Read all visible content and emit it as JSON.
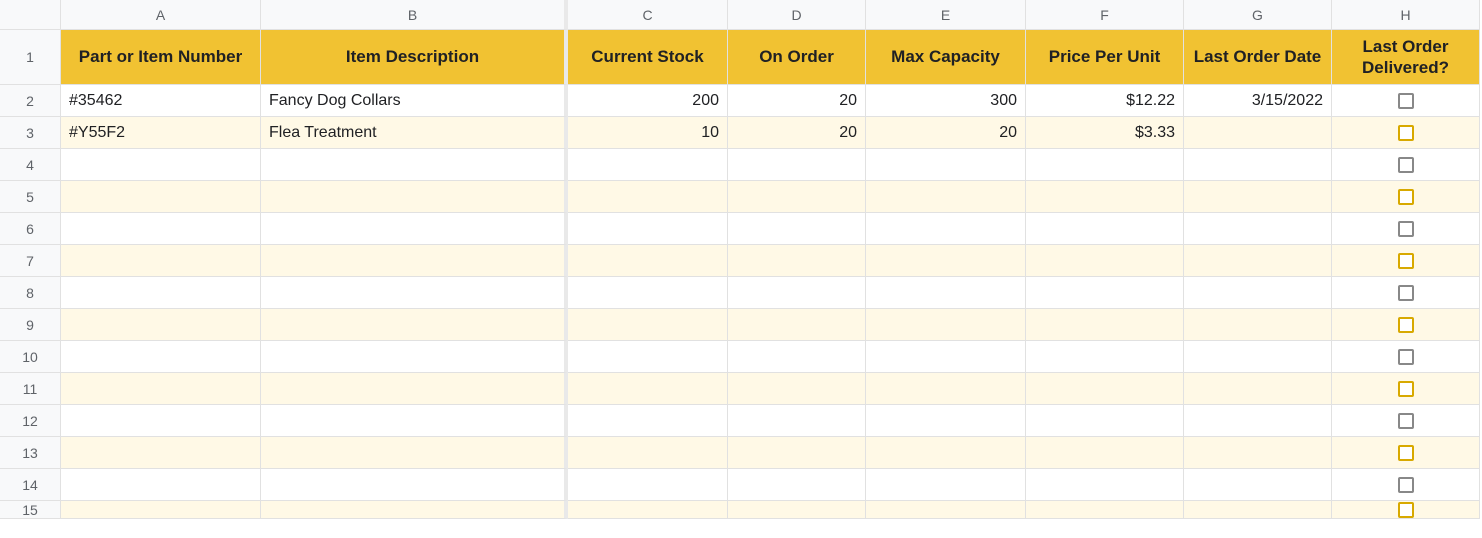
{
  "colLetters": [
    "A",
    "B",
    "C",
    "D",
    "E",
    "F",
    "G",
    "H"
  ],
  "colWidths": [
    "wA",
    "wB",
    "wC",
    "wD",
    "wE",
    "wF",
    "wG",
    "wH"
  ],
  "headers": {
    "A": "Part or Item Number",
    "B": "Item Description",
    "C": "Current Stock",
    "D": "On Order",
    "E": "Max Capacity",
    "F": "Price Per Unit",
    "G": "Last Order Date",
    "H": "Last Order Delivered?"
  },
  "rows": [
    {
      "num": "2",
      "stripe": "even",
      "A": "#35462",
      "B": "Fancy Dog Collars",
      "C": "200",
      "D": "20",
      "E": "300",
      "F": "$12.22",
      "G": "3/15/2022",
      "H": "checkbox"
    },
    {
      "num": "3",
      "stripe": "odd",
      "A": "#Y55F2",
      "B": "Flea Treatment",
      "C": "10",
      "D": "20",
      "E": "20",
      "F": "$3.33",
      "G": "",
      "H": "checkbox"
    },
    {
      "num": "4",
      "stripe": "even",
      "A": "",
      "B": "",
      "C": "",
      "D": "",
      "E": "",
      "F": "",
      "G": "",
      "H": "checkbox"
    },
    {
      "num": "5",
      "stripe": "odd",
      "A": "",
      "B": "",
      "C": "",
      "D": "",
      "E": "",
      "F": "",
      "G": "",
      "H": "checkbox"
    },
    {
      "num": "6",
      "stripe": "even",
      "A": "",
      "B": "",
      "C": "",
      "D": "",
      "E": "",
      "F": "",
      "G": "",
      "H": "checkbox"
    },
    {
      "num": "7",
      "stripe": "odd",
      "A": "",
      "B": "",
      "C": "",
      "D": "",
      "E": "",
      "F": "",
      "G": "",
      "H": "checkbox"
    },
    {
      "num": "8",
      "stripe": "even",
      "A": "",
      "B": "",
      "C": "",
      "D": "",
      "E": "",
      "F": "",
      "G": "",
      "H": "checkbox"
    },
    {
      "num": "9",
      "stripe": "odd",
      "A": "",
      "B": "",
      "C": "",
      "D": "",
      "E": "",
      "F": "",
      "G": "",
      "H": "checkbox"
    },
    {
      "num": "10",
      "stripe": "even",
      "A": "",
      "B": "",
      "C": "",
      "D": "",
      "E": "",
      "F": "",
      "G": "",
      "H": "checkbox"
    },
    {
      "num": "11",
      "stripe": "odd",
      "A": "",
      "B": "",
      "C": "",
      "D": "",
      "E": "",
      "F": "",
      "G": "",
      "H": "checkbox"
    },
    {
      "num": "12",
      "stripe": "even",
      "A": "",
      "B": "",
      "C": "",
      "D": "",
      "E": "",
      "F": "",
      "G": "",
      "H": "checkbox"
    },
    {
      "num": "13",
      "stripe": "odd",
      "A": "",
      "B": "",
      "C": "",
      "D": "",
      "E": "",
      "F": "",
      "G": "",
      "H": "checkbox"
    },
    {
      "num": "14",
      "stripe": "even",
      "A": "",
      "B": "",
      "C": "",
      "D": "",
      "E": "",
      "F": "",
      "G": "",
      "H": "checkbox"
    },
    {
      "num": "15",
      "stripe": "odd",
      "A": "",
      "B": "",
      "C": "",
      "D": "",
      "E": "",
      "F": "",
      "G": "",
      "H": "checkbox"
    }
  ],
  "alignments": {
    "A": "txt",
    "B": "txt",
    "C": "num",
    "D": "num",
    "E": "num",
    "F": "num",
    "G": "num",
    "H": "center"
  }
}
